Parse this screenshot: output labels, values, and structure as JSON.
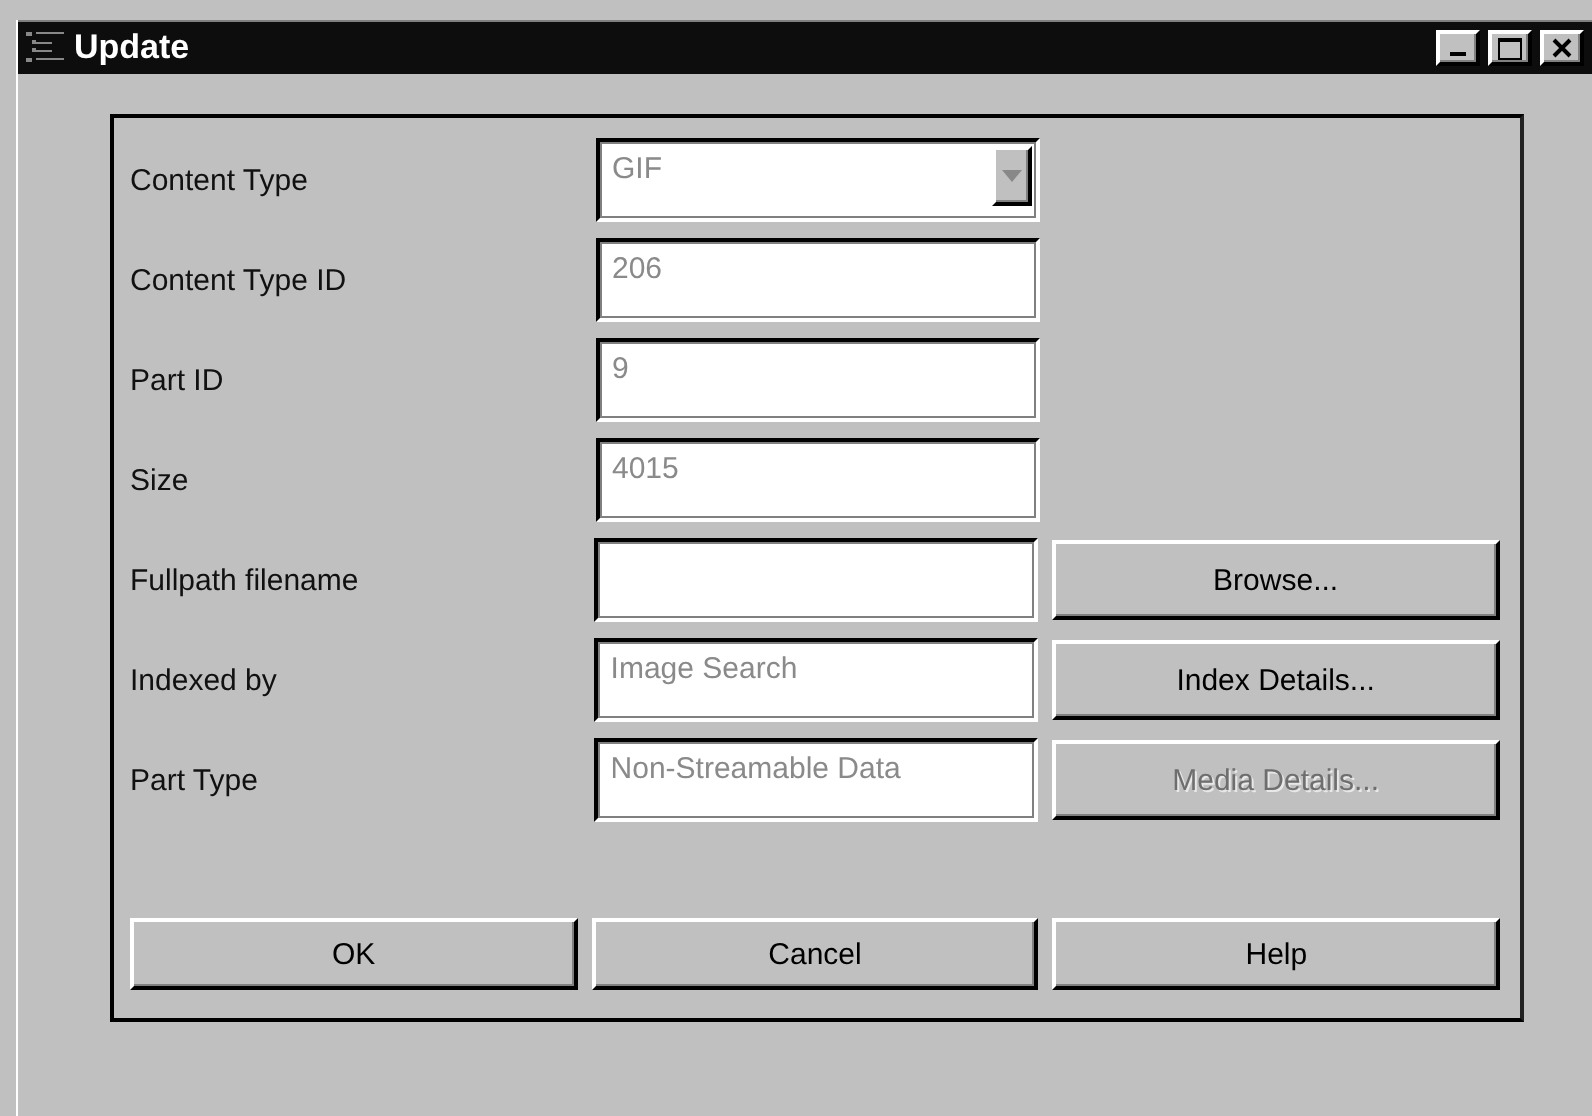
{
  "window": {
    "title": "Update"
  },
  "rows": [
    {
      "label": "Content Type",
      "field": {
        "kind": "combo",
        "value": "GIF",
        "disabled": true
      }
    },
    {
      "label": "Content Type ID",
      "field": {
        "kind": "text",
        "value": "206",
        "disabled": true
      }
    },
    {
      "label": "Part ID",
      "field": {
        "kind": "text",
        "value": "9",
        "disabled": true
      }
    },
    {
      "label": "Size",
      "field": {
        "kind": "text",
        "value": "4015",
        "disabled": true
      }
    },
    {
      "label": "Fullpath filename",
      "field": {
        "kind": "text"
      },
      "button": {
        "label": "Browse...",
        "disabled": false
      }
    },
    {
      "label": "Indexed by",
      "field": {
        "kind": "text",
        "value": "Image Search",
        "disabled": true
      },
      "button": {
        "label": "Index Details...",
        "disabled": false
      }
    },
    {
      "label": "Part Type",
      "field": {
        "kind": "text",
        "value": "Non-Streamable Data",
        "disabled": true
      },
      "button": {
        "label": "Media Details...",
        "disabled": true
      }
    }
  ],
  "buttons": [
    {
      "label": "OK"
    },
    {
      "label": "Cancel"
    },
    {
      "label": "Help"
    }
  ]
}
